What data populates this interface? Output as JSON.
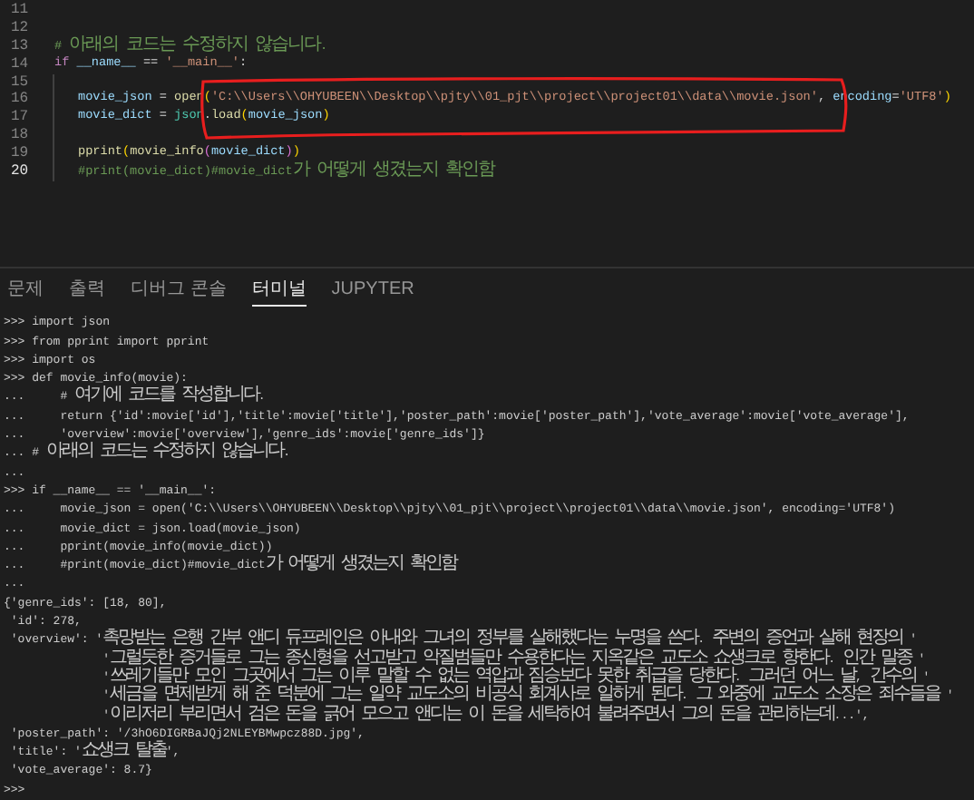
{
  "editor": {
    "lines": [
      {
        "number": "11",
        "current": false,
        "indented": false
      },
      {
        "number": "12",
        "current": false,
        "indented": false
      },
      {
        "number": "13",
        "current": false,
        "indented": false,
        "segments": [
          {
            "text": "# 아래의 코드는 수정하지 않습니다.",
            "kind": "comment"
          }
        ]
      },
      {
        "number": "14",
        "current": false,
        "indented": false,
        "segments": [
          {
            "text": "if",
            "kind": "keyword"
          },
          {
            "text": " __name__",
            "kind": "variable"
          },
          {
            "text": " == ",
            "kind": "plain"
          },
          {
            "text": "'__main__'",
            "kind": "string"
          },
          {
            "text": ":",
            "kind": "plain"
          }
        ]
      },
      {
        "number": "15",
        "current": false,
        "indented": true
      },
      {
        "number": "16",
        "current": false,
        "indented": true,
        "segments": [
          {
            "text": "movie_json",
            "kind": "variable"
          },
          {
            "text": " = ",
            "kind": "plain"
          },
          {
            "text": "open",
            "kind": "function"
          },
          {
            "text": "(",
            "kind": "bracket"
          },
          {
            "text": "'C:\\\\Users\\\\OHYUBEEN\\\\Desktop\\\\pjty\\\\01_pjt\\\\project\\\\project01\\\\data\\\\movie.json'",
            "kind": "string"
          },
          {
            "text": ", ",
            "kind": "plain"
          },
          {
            "text": "encoding",
            "kind": "variable"
          },
          {
            "text": "=",
            "kind": "plain"
          },
          {
            "text": "'UTF8'",
            "kind": "string"
          },
          {
            "text": ")",
            "kind": "bracket"
          }
        ]
      },
      {
        "number": "17",
        "current": false,
        "indented": true,
        "segments": [
          {
            "text": "movie_dict",
            "kind": "variable"
          },
          {
            "text": " = ",
            "kind": "plain"
          },
          {
            "text": "json",
            "kind": "module"
          },
          {
            "text": ".",
            "kind": "plain"
          },
          {
            "text": "load",
            "kind": "function"
          },
          {
            "text": "(",
            "kind": "bracket"
          },
          {
            "text": "movie_json",
            "kind": "variable"
          },
          {
            "text": ")",
            "kind": "bracket"
          }
        ]
      },
      {
        "number": "18",
        "current": false,
        "indented": true
      },
      {
        "number": "19",
        "current": false,
        "indented": true,
        "segments": [
          {
            "text": "pprint",
            "kind": "function"
          },
          {
            "text": "(",
            "kind": "bracket"
          },
          {
            "text": "movie_info",
            "kind": "function"
          },
          {
            "text": "(",
            "kind": "bracket2"
          },
          {
            "text": "movie_dict",
            "kind": "variable"
          },
          {
            "text": ")",
            "kind": "bracket2"
          },
          {
            "text": ")",
            "kind": "bracket"
          }
        ]
      },
      {
        "number": "20",
        "current": true,
        "indented": true,
        "segments": [
          {
            "text": "#print(movie_dict)#movie_dict가 어떻게 생겼는지 확인함",
            "kind": "comment"
          }
        ]
      }
    ]
  },
  "panel": {
    "tabs": [
      {
        "label": "문제",
        "selected": false
      },
      {
        "label": "출력",
        "selected": false
      },
      {
        "label": "디버그 콘솔",
        "selected": false
      },
      {
        "label": "터미널",
        "selected": true
      },
      {
        "label": "JUPYTER",
        "selected": false
      }
    ]
  },
  "terminal": {
    "lines": [
      ">>> import json",
      ">>> from pprint import pprint",
      ">>> import os",
      ">>> def movie_info(movie):",
      "...     # 여기에 코드를 작성합니다.",
      "...     return {'id':movie['id'],'title':movie['title'],'poster_path':movie['poster_path'],'vote_average':movie['vote_average'],",
      "...     'overview':movie['overview'],'genre_ids':movie['genre_ids']}",
      "... # 아래의 코드는 수정하지 않습니다.",
      "...",
      ">>> if __name__ == '__main__':",
      "...     movie_json = open('C:\\\\Users\\\\OHYUBEEN\\\\Desktop\\\\pjty\\\\01_pjt\\\\project\\\\project01\\\\data\\\\movie.json', encoding='UTF8')",
      "...     movie_dict = json.load(movie_json)",
      "...     pprint(movie_info(movie_dict))",
      "...     #print(movie_dict)#movie_dict가 어떻게 생겼는지 확인함",
      "...",
      "{'genre_ids': [18, 80],",
      " 'id': 278,",
      " 'overview': '촉망받는 은행 간부 앤디 듀프레인은 아내와 그녀의 정부를 살해했다는 누명을 쓴다. 주변의 증언과 살해 현장의 '",
      "              '그럴듯한 증거들로 그는 종신형을 선고받고 악질범들만 수용한다는 지옥같은 교도소 쇼생크로 향한다. 인간 말종 '",
      "              '쓰레기들만 모인 그곳에서 그는 이루 말할 수 없는 역압과 짐승보다 못한 취급을 당한다. 그러던 어느 날, 간수의 '",
      "              '세금을 면제받게 해 준 덕분에 그는 일약 교도소의 비공식 회계사로 일하게 된다. 그 와중에 교도소 소장은 죄수들을 '",
      "              '이리저리 부리면서 검은 돈을 긁어 모으고 앤디는 이 돈을 세탁하여 불려주면서 그의 돈을 관리하는데...',",
      " 'poster_path': '/3hO6DIGRBaJQj2NLEYBMwpcz88D.jpg',",
      " 'title': '쇼생크 탈출',",
      " 'vote_average': 8.7}",
      ">>>"
    ]
  }
}
